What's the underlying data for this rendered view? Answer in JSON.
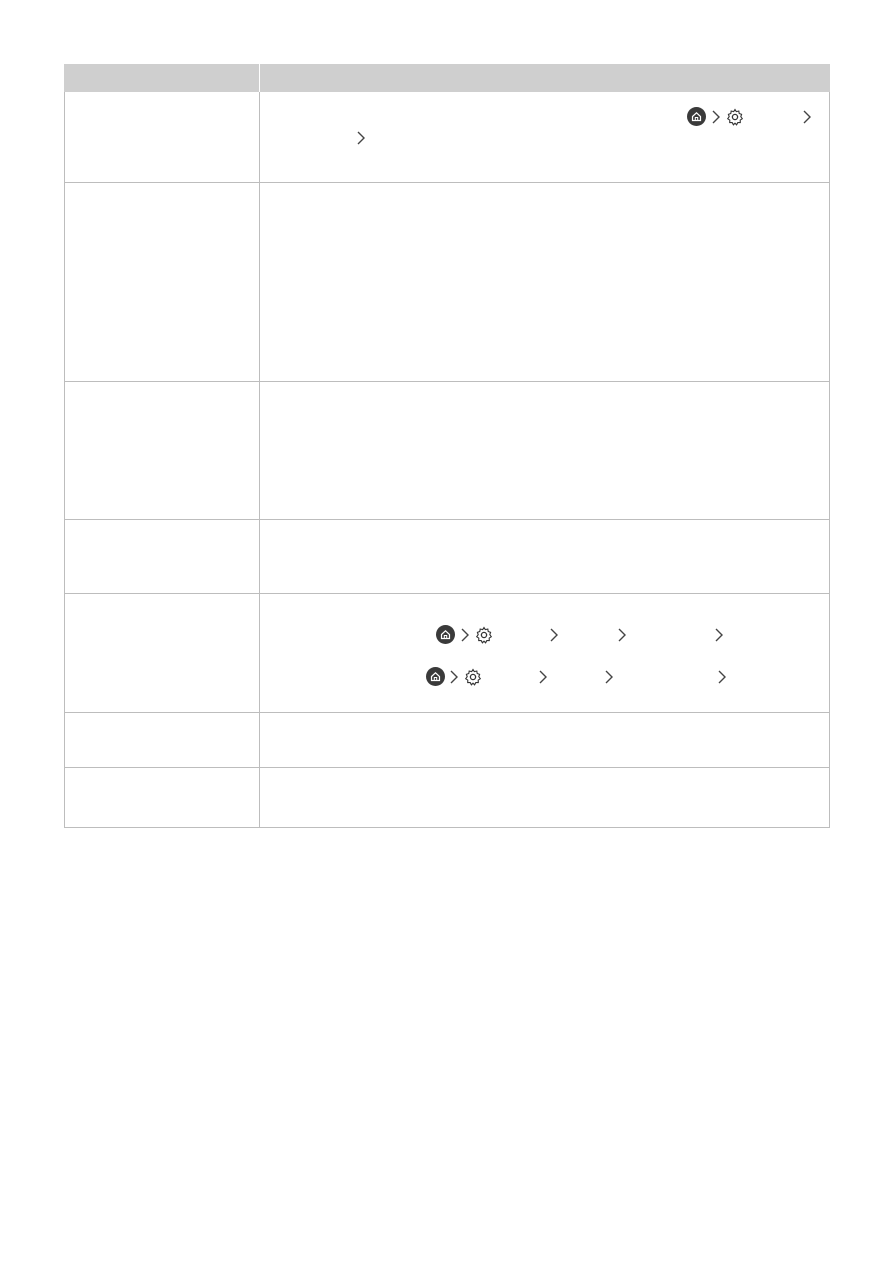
{
  "table": {
    "header": [
      "",
      ""
    ],
    "rows": [
      {
        "label": "",
        "text": ""
      },
      {
        "label": "",
        "text": ""
      },
      {
        "label": "",
        "text": ""
      },
      {
        "label": "",
        "text": ""
      },
      {
        "label": "",
        "text": ""
      },
      {
        "label": "",
        "text": ""
      },
      {
        "label": "",
        "text": ""
      }
    ]
  },
  "icons": [
    "home-icon",
    "settings-icon",
    "chevron-right-icon"
  ],
  "colors": {
    "header_bg": "#cfcfcf",
    "border": "#bdbdbd",
    "icon": "#3a3a3a"
  }
}
